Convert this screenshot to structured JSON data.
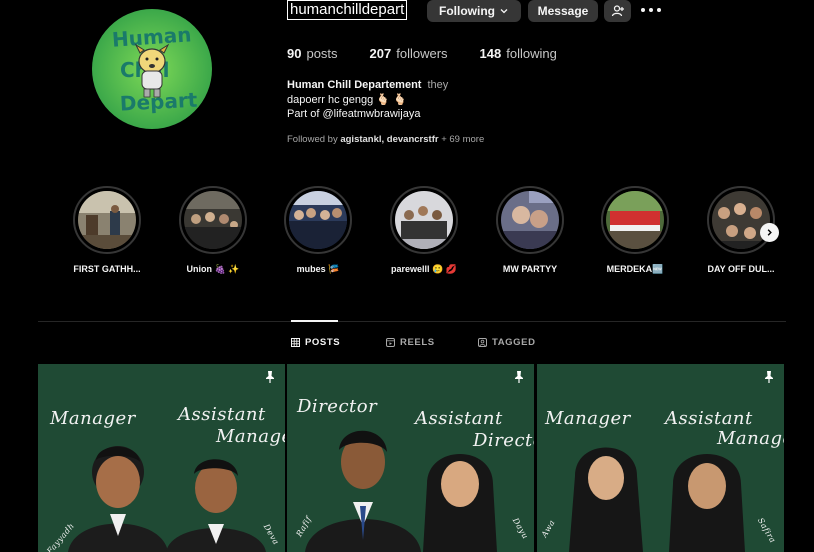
{
  "profile": {
    "username": "humanchilldepart",
    "avatar_text_line1": "Human",
    "avatar_text_line2": "Chill",
    "avatar_text_line3": "Depart",
    "following_label": "Following",
    "message_label": "Message",
    "posts_count": "90",
    "posts_label": "posts",
    "followers_count": "207",
    "followers_label": "followers",
    "following_count": "148",
    "following_text": "following",
    "display_name": "Human Chill Departement",
    "pronoun": "they",
    "bio_line1": "dapoerr hc gengg 🫰🏻 🫰🏻",
    "bio_line2": "Part of @lifeatmwbrawijaya",
    "followed_by_prefix": "Followed by",
    "followed_by_names": "agistankl, devancrstfr",
    "followed_by_more": "+ 69 more"
  },
  "highlights": [
    {
      "label": "FIRST GATHH..."
    },
    {
      "label": "Union 🍇 ✨"
    },
    {
      "label": "mubes 🎏"
    },
    {
      "label": "parewelll 🥲 💋"
    },
    {
      "label": "MW PARTYY"
    },
    {
      "label": "MERDEKA🆕"
    },
    {
      "label": "DAY OFF DUL..."
    }
  ],
  "tabs": {
    "posts": "POSTS",
    "reels": "REELS",
    "tagged": "TAGGED"
  },
  "posts": [
    {
      "title_left": "Manager",
      "title_right_1": "Assistant",
      "title_right_2": "Manager",
      "name_left": "Fayyadh",
      "name_right": "Deva"
    },
    {
      "title_left": "Director",
      "title_right_1": "Assistant",
      "title_right_2": "Director",
      "name_left": "Rafif",
      "name_right": "Dayu"
    },
    {
      "title_left": "Manager",
      "title_right_1": "Assistant",
      "title_right_2": "Manager",
      "name_left": "Awa",
      "name_right": "Safira"
    }
  ],
  "colors": {
    "background": "#000000",
    "button": "#363636",
    "post_green": "#1f4a34",
    "avatar_green": "#4caf50"
  }
}
